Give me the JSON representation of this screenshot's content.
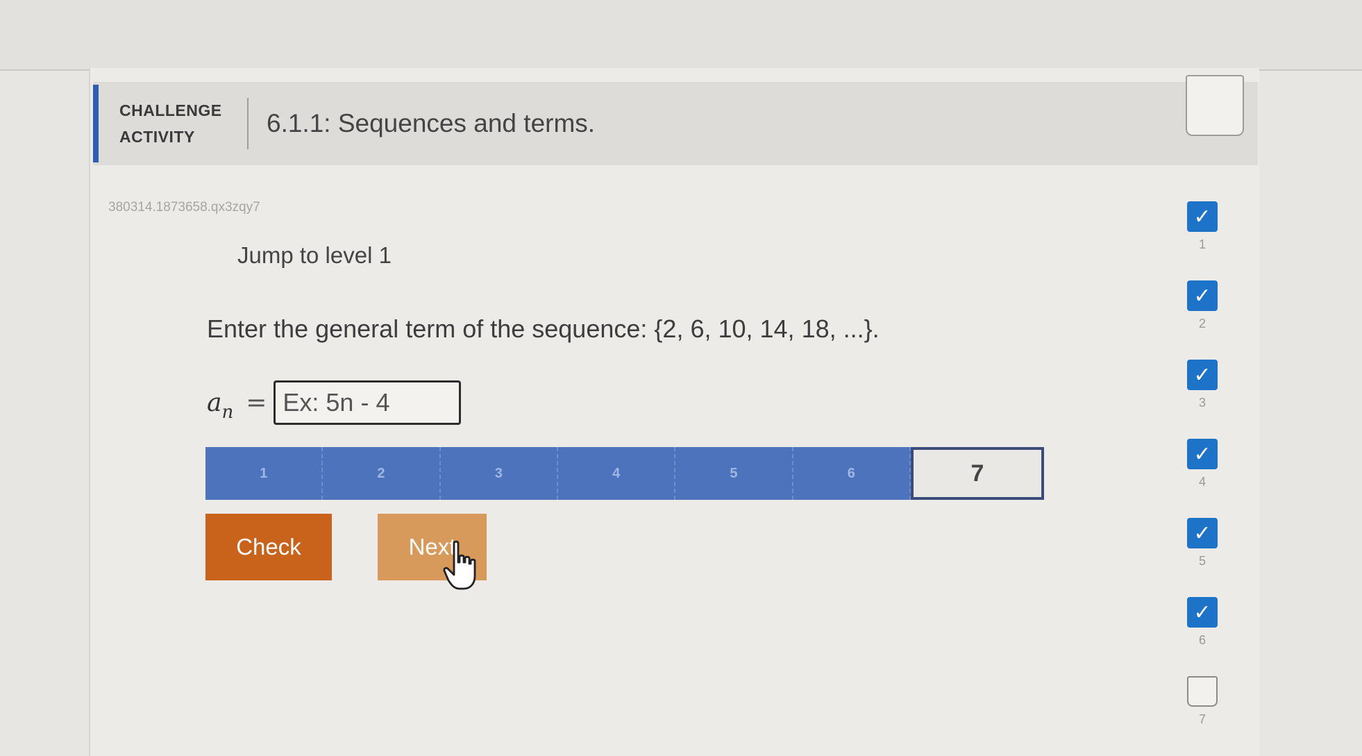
{
  "header": {
    "label": "CHALLENGE\nACTIVITY",
    "title": "6.1.1: Sequences and terms."
  },
  "activity_id": "380314.1873658.qx3zqy7",
  "jump_link": "Jump to level 1",
  "question": "Enter the general term of the sequence: {2, 6, 10, 14, 18, ...}.",
  "answer": {
    "variable": "a",
    "subscript": "n",
    "equals": "=",
    "value": "",
    "placeholder": "Ex: 5n - 4"
  },
  "levels": {
    "items": [
      "1",
      "2",
      "3",
      "4",
      "5",
      "6",
      "7"
    ],
    "current": "7",
    "completed_color": "#4d73bd"
  },
  "buttons": {
    "check": "Check",
    "next": "Next"
  },
  "progress": {
    "steps": [
      {
        "number": "1",
        "completed": true,
        "icon": "checkmark-icon"
      },
      {
        "number": "2",
        "completed": true,
        "icon": "checkmark-icon"
      },
      {
        "number": "3",
        "completed": true,
        "icon": "checkmark-icon"
      },
      {
        "number": "4",
        "completed": true,
        "icon": "checkmark-icon"
      },
      {
        "number": "5",
        "completed": true,
        "icon": "checkmark-icon"
      },
      {
        "number": "6",
        "completed": true,
        "icon": "checkmark-icon"
      },
      {
        "number": "7",
        "completed": false,
        "icon": "empty-box-icon"
      }
    ],
    "check_glyph": "✓"
  },
  "colors": {
    "accent": "#2f5fb0",
    "check_button": "#c9621b",
    "next_button": "#d89a5a",
    "progress_complete": "#1d73c8"
  }
}
